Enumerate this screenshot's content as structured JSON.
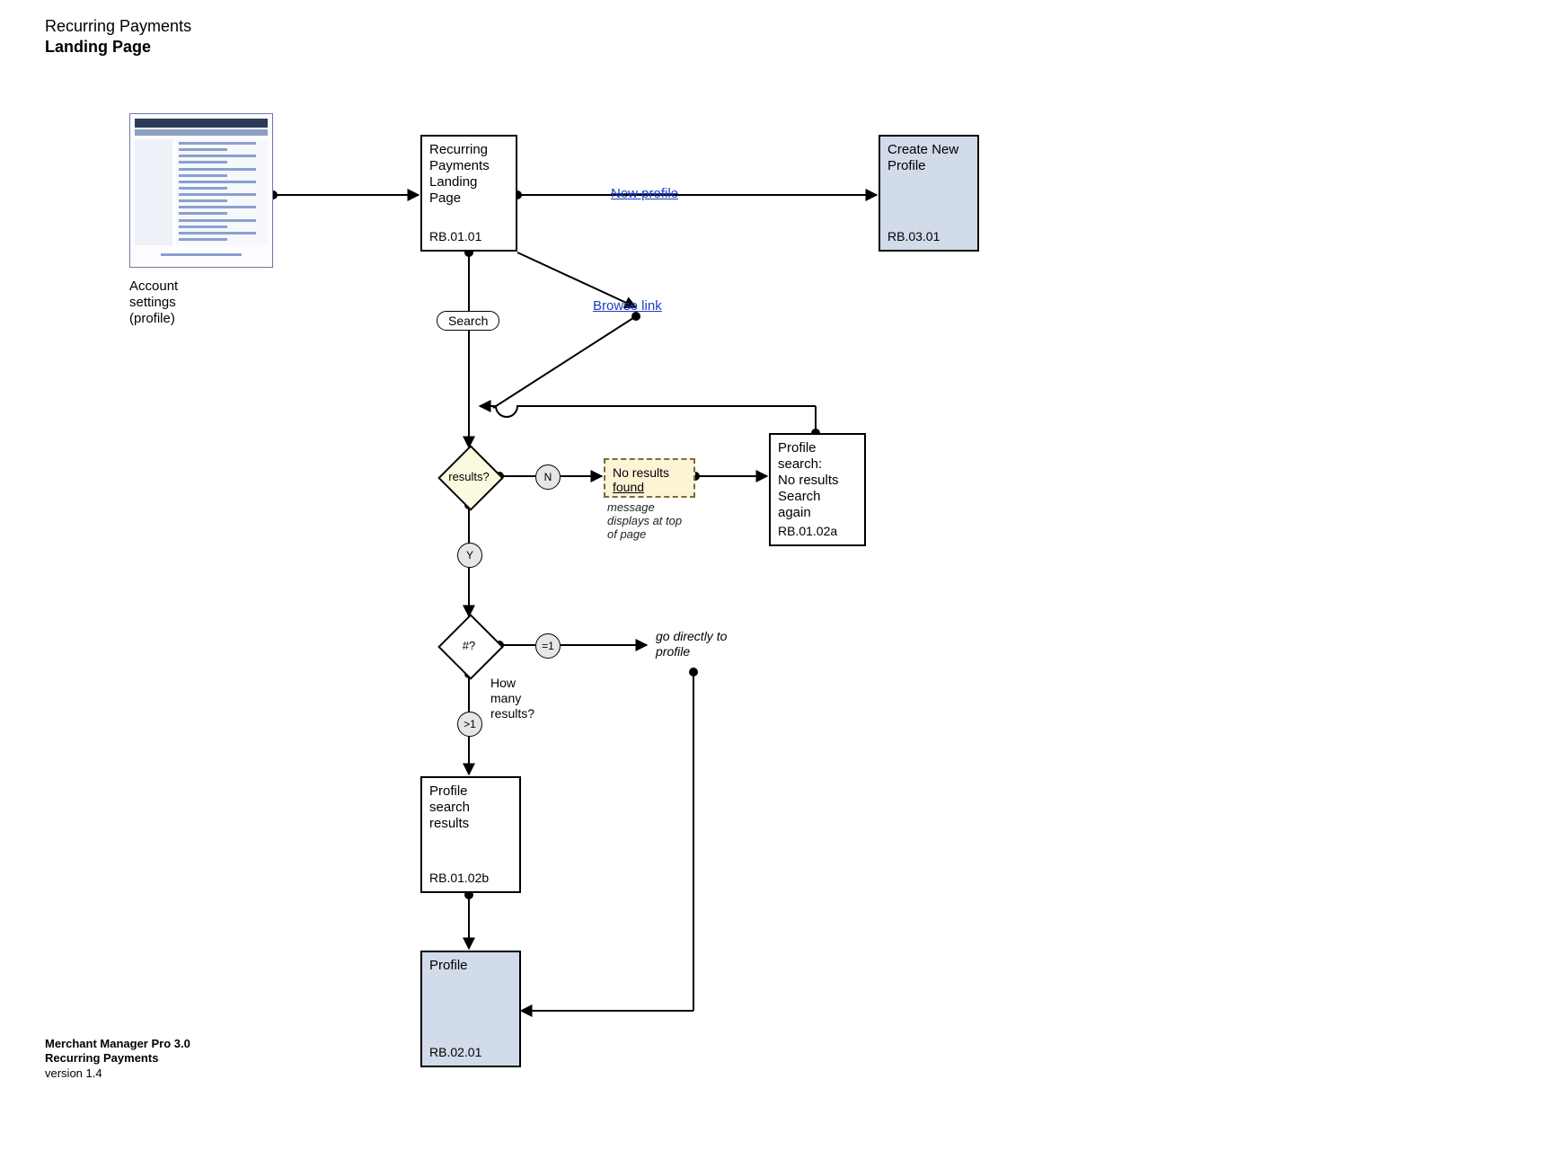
{
  "header": {
    "line1": "Recurring Payments",
    "line2": "Landing Page"
  },
  "footer": {
    "line1": "Merchant Manager Pro 3.0",
    "line2": "Recurring Payments",
    "line3": "version 1.4"
  },
  "thumbnail": {
    "caption_line1": "Account",
    "caption_line2": "settings",
    "caption_line3": "(profile)"
  },
  "nodes": {
    "landing": {
      "title_l1": "Recurring",
      "title_l2": "Payments",
      "title_l3": "Landing",
      "title_l4": "Page",
      "id": "RB.01.01"
    },
    "create_profile": {
      "title_l1": "Create New",
      "title_l2": "Profile",
      "id": "RB.03.01"
    },
    "no_results_page": {
      "title_l1": "Profile",
      "title_l2": "search:",
      "title_l3": "No results",
      "title_l4": "Search again",
      "id": "RB.01.02a"
    },
    "search_results": {
      "title_l1": "Profile",
      "title_l2": "search",
      "title_l3": "results",
      "id": "RB.01.02b"
    },
    "profile": {
      "title": "Profile",
      "id": "RB.02.01"
    }
  },
  "decisions": {
    "results": {
      "label": "results?",
      "yes": "Y",
      "no": "N"
    },
    "count": {
      "label": "#?",
      "caption_l1": "How",
      "caption_l2": "many",
      "caption_l3": "results?",
      "eq1": "=1",
      "gt1": ">1"
    }
  },
  "search_pill": "Search",
  "edge_labels": {
    "new_profile": "New profile",
    "browse_link": "Browse link",
    "go_direct_l1": "go directly to",
    "go_direct_l2": "profile"
  },
  "note": {
    "line1": "No results",
    "line2": "found",
    "caption_l1": "message",
    "caption_l2": "displays at top",
    "caption_l3": "of page"
  }
}
